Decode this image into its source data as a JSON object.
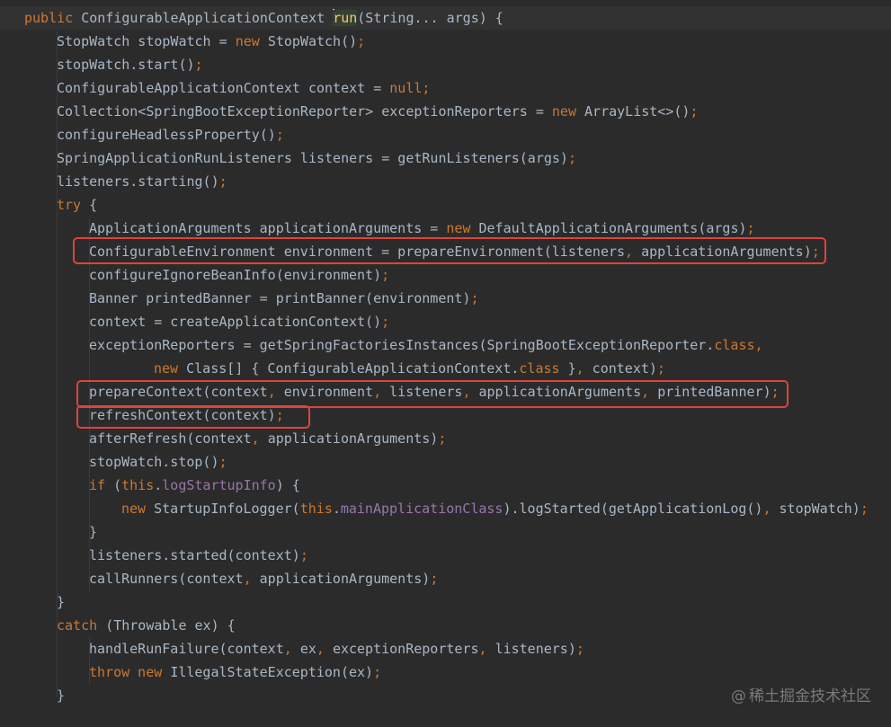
{
  "code": {
    "lines": [
      [
        [
          "k",
          "public "
        ],
        [
          "n",
          "ConfigurableApplicationContext "
        ],
        [
          "caret",
          ""
        ],
        [
          "f",
          "run"
        ],
        [
          "n",
          "(String... args) {"
        ]
      ],
      [
        [
          "n",
          "StopWatch stopWatch = "
        ],
        [
          "k",
          "new "
        ],
        [
          "n",
          "StopWatch()"
        ],
        [
          "k",
          ";"
        ]
      ],
      [
        [
          "n",
          "stopWatch.start()"
        ],
        [
          "k",
          ";"
        ]
      ],
      [
        [
          "n",
          "ConfigurableApplicationContext context = "
        ],
        [
          "k",
          "null;"
        ]
      ],
      [
        [
          "n",
          "Collection<SpringBootExceptionReporter> exceptionReporters = "
        ],
        [
          "k",
          "new "
        ],
        [
          "n",
          "ArrayList<>()"
        ],
        [
          "k",
          ";"
        ]
      ],
      [
        [
          "n",
          "configureHeadlessProperty()"
        ],
        [
          "k",
          ";"
        ]
      ],
      [
        [
          "n",
          "SpringApplicationRunListeners listeners = getRunListeners(args)"
        ],
        [
          "k",
          ";"
        ]
      ],
      [
        [
          "n",
          "listeners.starting()"
        ],
        [
          "k",
          ";"
        ]
      ],
      [
        [
          "k",
          "try "
        ],
        [
          "n",
          "{"
        ]
      ],
      [
        [
          "n",
          "ApplicationArguments applicationArguments = "
        ],
        [
          "k",
          "new "
        ],
        [
          "n",
          "DefaultApplicationArguments(args)"
        ],
        [
          "k",
          ";"
        ]
      ],
      [
        [
          "n",
          "ConfigurableEnvironment environment = prepareEnvironment(listeners"
        ],
        [
          "k",
          ", "
        ],
        [
          "n",
          "applicationArguments)"
        ],
        [
          "k",
          ";"
        ]
      ],
      [
        [
          "n",
          "configureIgnoreBeanInfo(environment)"
        ],
        [
          "k",
          ";"
        ]
      ],
      [
        [
          "n",
          "Banner printedBanner = printBanner(environment)"
        ],
        [
          "k",
          ";"
        ]
      ],
      [
        [
          "n",
          "context = createApplicationContext()"
        ],
        [
          "k",
          ";"
        ]
      ],
      [
        [
          "n",
          "exceptionReporters = getSpringFactoriesInstances(SpringBootExceptionReporter."
        ],
        [
          "k",
          "class,"
        ]
      ],
      [
        [
          "k",
          "new "
        ],
        [
          "n",
          "Class[] { ConfigurableApplicationContext."
        ],
        [
          "k",
          "class "
        ],
        [
          "n",
          "}"
        ],
        [
          "k",
          ", "
        ],
        [
          "n",
          "context)"
        ],
        [
          "k",
          ";"
        ]
      ],
      [
        [
          "n",
          "prepareContext(context"
        ],
        [
          "k",
          ", "
        ],
        [
          "n",
          "environment"
        ],
        [
          "k",
          ", "
        ],
        [
          "n",
          "listeners"
        ],
        [
          "k",
          ", "
        ],
        [
          "n",
          "applicationArguments"
        ],
        [
          "k",
          ", "
        ],
        [
          "n",
          "printedBanner)"
        ],
        [
          "k",
          ";"
        ]
      ],
      [
        [
          "n",
          "refreshContext(context)"
        ],
        [
          "k",
          ";"
        ]
      ],
      [
        [
          "n",
          "afterRefresh(context"
        ],
        [
          "k",
          ", "
        ],
        [
          "n",
          "applicationArguments)"
        ],
        [
          "k",
          ";"
        ]
      ],
      [
        [
          "n",
          "stopWatch.stop()"
        ],
        [
          "k",
          ";"
        ]
      ],
      [
        [
          "k",
          "if "
        ],
        [
          "n",
          "("
        ],
        [
          "k",
          "this"
        ],
        [
          "n",
          "."
        ],
        [
          "p",
          "logStartupInfo"
        ],
        [
          "n",
          ") {"
        ]
      ],
      [
        [
          "k",
          "new "
        ],
        [
          "n",
          "StartupInfoLogger("
        ],
        [
          "k",
          "this"
        ],
        [
          "n",
          "."
        ],
        [
          "p",
          "mainApplicationClass"
        ],
        [
          "n",
          ").logStarted(getApplicationLog()"
        ],
        [
          "k",
          ", "
        ],
        [
          "n",
          "stopWatch)"
        ],
        [
          "k",
          ";"
        ]
      ],
      [
        [
          "n",
          "}"
        ]
      ],
      [
        [
          "n",
          "listeners.started(context)"
        ],
        [
          "k",
          ";"
        ]
      ],
      [
        [
          "n",
          "callRunners(context"
        ],
        [
          "k",
          ", "
        ],
        [
          "n",
          "applicationArguments)"
        ],
        [
          "k",
          ";"
        ]
      ],
      [
        [
          "n",
          "}"
        ]
      ],
      [
        [
          "k",
          "catch "
        ],
        [
          "n",
          "(Throwable ex) {"
        ]
      ],
      [
        [
          "n",
          "handleRunFailure(context"
        ],
        [
          "k",
          ", "
        ],
        [
          "n",
          "ex"
        ],
        [
          "k",
          ", "
        ],
        [
          "n",
          "exceptionReporters"
        ],
        [
          "k",
          ", "
        ],
        [
          "n",
          "listeners)"
        ],
        [
          "k",
          ";"
        ]
      ],
      [
        [
          "k",
          "throw new "
        ],
        [
          "n",
          "IllegalStateException(ex)"
        ],
        [
          "k",
          ";"
        ]
      ],
      [
        [
          "n",
          "}"
        ]
      ]
    ]
  },
  "watermark": {
    "at": "@",
    "text": "稀土掘金技术社区"
  },
  "colors": {
    "background": "#2b2b2b",
    "keyword": "#cc7832",
    "method_declaration": "#ffc66d",
    "field": "#9876aa",
    "text": "#a9b7c6",
    "highlight_box": "#e0433a"
  }
}
